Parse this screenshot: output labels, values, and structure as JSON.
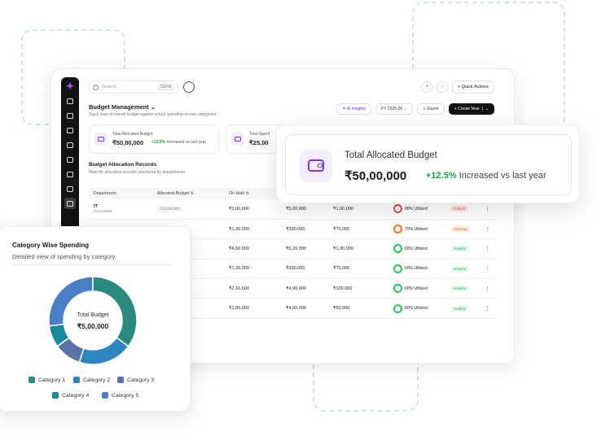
{
  "app": {
    "search": {
      "placeholder": "Search...",
      "shortcut": "Ctrl+K"
    },
    "quick_actions": "Quick Actions",
    "header": {
      "title": "Budget Management",
      "subtitle": "Track year of overall budget against actual spending across categories",
      "ai_insights": "AI Insights",
      "fiscal_year": "FY 2025-26",
      "export": "Export",
      "create_new": "Create New"
    },
    "kpis": [
      {
        "label": "Total Allocated Budget",
        "value": "₹50,00,000",
        "delta": "+12.5%",
        "delta_text": "Increased vs last year"
      },
      {
        "label": "Total Spent",
        "value": "₹25,00"
      }
    ],
    "section": {
      "title": "Budget Allocation Records",
      "subtitle": "Main for allocation records structured by departments"
    },
    "table": {
      "columns": [
        "Department",
        "Allocated Budget",
        "On Hold",
        "",
        "",
        "",
        "",
        ""
      ],
      "rows": [
        {
          "dept": "IT",
          "code": "IT11234689",
          "allocated": "₹10,00,000",
          "on_hold": "₹3,00,000",
          "c4": "₹5,00,000",
          "c5": "₹1,00,000",
          "util": "90% Utilized",
          "status": "Critical"
        },
        {
          "dept": "",
          "code": "",
          "allocated": "",
          "on_hold": "₹1,20,000",
          "c4": "₹330,000",
          "c5": "₹70,000",
          "util": "70% Utilized",
          "status": "Warning"
        },
        {
          "dept": "",
          "code": "",
          "allocated": "",
          "on_hold": "₹4,50,000",
          "c4": "₹5,20,000",
          "c5": "₹1,30,000",
          "util": "60% Utilized",
          "status": "Healthy"
        },
        {
          "dept": "",
          "code": "",
          "allocated": "",
          "on_hold": "₹1,20,000",
          "c4": "₹330,000",
          "c5": "₹70,000",
          "util": "60% Utilized",
          "status": "Healthy"
        },
        {
          "dept": "",
          "code": "",
          "allocated": "",
          "on_hold": "₹2,10,600",
          "c4": "₹4,90,000",
          "c5": "₹100,000",
          "util": "60% Utilized",
          "status": "Healthy"
        },
        {
          "dept": "",
          "code": "",
          "allocated": "",
          "on_hold": "₹1,80,000",
          "c4": "₹4,50,000",
          "c5": "₹60,000",
          "util": "60% Utilized",
          "status": "Healthy"
        }
      ]
    },
    "colors": {
      "accent": "#7c3aed",
      "positive": "#16a34a",
      "critical": "#ef4444",
      "warning": "#f97316",
      "healthy": "#22c55e"
    },
    "icons": [
      "logo-icon",
      "wallet-icon",
      "document-icon",
      "clipboard-icon",
      "file-search-icon",
      "bank-icon",
      "cart-icon",
      "user-icon",
      "grid-icon",
      "history-icon",
      "chat-icon",
      "bell-icon",
      "plus-icon",
      "sparkle-icon",
      "calendar-icon",
      "export-icon"
    ]
  },
  "popup": {
    "label": "Total Allocated Budget",
    "value": "₹50,00,000",
    "delta": "+12.5%",
    "delta_text": "Increased vs last year"
  },
  "donut_card": {
    "title": "Category Wise Spending",
    "subtitle": "Detailed view of spending by category",
    "center_label": "Total Budget",
    "center_value": "₹5,00,000",
    "legend": [
      "Category 1",
      "Category 2",
      "Category 3",
      "Category 4",
      "Category 5"
    ]
  },
  "chart_data": {
    "type": "pie",
    "title": "Category Wise Spending",
    "categories": [
      "Category 1",
      "Category 2",
      "Category 3",
      "Category 4",
      "Category 5"
    ],
    "values": [
      35,
      20,
      10,
      8,
      27
    ],
    "colors": [
      "#2a8a7d",
      "#2e86c1",
      "#5b73a8",
      "#168a9a",
      "#4a7fc7"
    ],
    "legend": "bottom"
  }
}
